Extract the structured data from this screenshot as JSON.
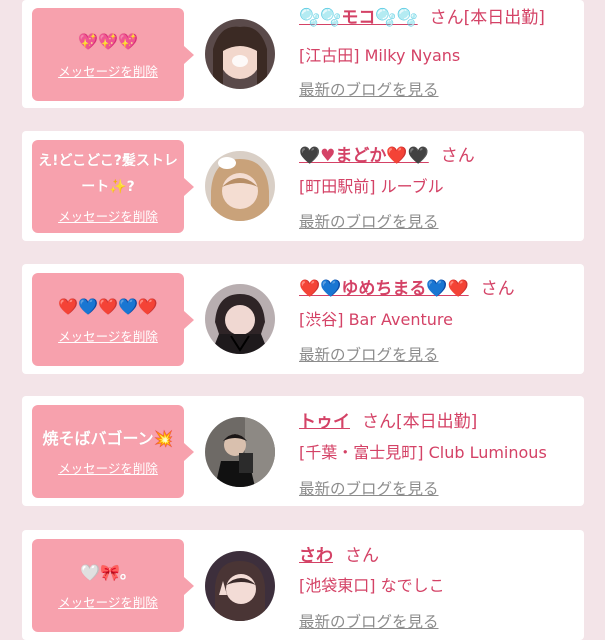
{
  "cards": [
    {
      "bubble_message": "💖💖💖",
      "delete_label": "メッセージを削除",
      "name": "🫧🫧モコ🫧🫧",
      "honorific": "さん",
      "status": "[本日出勤]",
      "shop": "[江古田] Milky Nyans",
      "blog_label": "最新のブログを見る"
    },
    {
      "bubble_message": "え!どこどこ?髪ストレート✨?",
      "delete_label": "メッセージを削除",
      "name": "🖤♥まどか❤️🖤",
      "honorific": "さん",
      "status": "",
      "shop": "[町田駅前] ルーブル",
      "blog_label": "最新のブログを見る"
    },
    {
      "bubble_message": "❤️💙❤️💙❤️",
      "delete_label": "メッセージを削除",
      "name": "❤️💙ゆめちまる💙❤️",
      "honorific": "さん",
      "status": "",
      "shop": "[渋谷] Bar Aventure",
      "blog_label": "最新のブログを見る"
    },
    {
      "bubble_message": "焼そばバゴーン💥",
      "delete_label": "メッセージを削除",
      "name": "トゥイ",
      "honorific": "さん",
      "status": "[本日出勤]",
      "shop": "[千葉・富士見町] Club Luminous",
      "blog_label": "最新のブログを見る"
    },
    {
      "bubble_message": "🤍🎀。",
      "delete_label": "メッセージを削除",
      "name": "さわ",
      "honorific": "さん",
      "status": "",
      "shop": "[池袋東口] なでしこ",
      "blog_label": "最新のブログを見る"
    }
  ],
  "colors": {
    "bubble": "#f7a1ad",
    "accent_text": "#d44266",
    "muted_link": "#8c8c8c",
    "background": "#f3e4e8"
  }
}
